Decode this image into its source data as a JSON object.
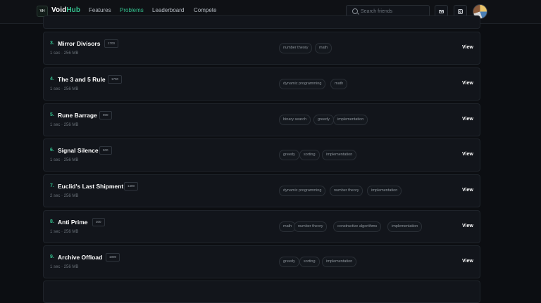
{
  "nav": {
    "logo_text": "VH",
    "brand_main": "Void",
    "brand_accent": "Hub",
    "links": [
      "Features",
      "Problems",
      "Leaderboard",
      "Compete"
    ],
    "active_link": "Problems",
    "search_placeholder": "Search friends",
    "icons": [
      "mail-icon",
      "instagram-icon"
    ]
  },
  "colors": {
    "accent": "#34c08e",
    "background": "#0c0e12",
    "card": "#12151b"
  },
  "problems": [
    {
      "num": "3.",
      "name": "Mirror Divisors",
      "rating": "1700",
      "meta": "1 sec · 256 MB",
      "tags": [
        "number theory",
        "math"
      ],
      "action": "View"
    },
    {
      "num": "4.",
      "name": "The 3 and 5 Rule",
      "rating": "1700",
      "meta": "1 sec · 256 MB",
      "tags": [
        "dynamic programming",
        "math"
      ],
      "action": "View"
    },
    {
      "num": "5.",
      "name": "Rune Barrage",
      "rating": "900",
      "meta": "1 sec · 256 MB",
      "tags": [
        "binary search",
        "greedy",
        "implementation"
      ],
      "action": "View"
    },
    {
      "num": "6.",
      "name": "Signal Silence",
      "rating": "500",
      "meta": "1 sec · 256 MB",
      "tags": [
        "greedy",
        "sorting",
        "implementation"
      ],
      "action": "View"
    },
    {
      "num": "7.",
      "name": "Euclid's Last Shipment",
      "rating": "1400",
      "meta": "2 sec · 256 MB",
      "tags": [
        "dynamic programming",
        "number theory",
        "implementation"
      ],
      "action": "View"
    },
    {
      "num": "8.",
      "name": "Anti Prime",
      "rating": "300",
      "meta": "1 sec · 256 MB",
      "tags": [
        "math",
        "number theory",
        "constructive algorithms",
        "implementation"
      ],
      "action": "View"
    },
    {
      "num": "9.",
      "name": "Archive Offload",
      "rating": "1000",
      "meta": "1 sec · 256 MB",
      "tags": [
        "greedy",
        "sorting",
        "implementation"
      ],
      "action": "View"
    }
  ]
}
